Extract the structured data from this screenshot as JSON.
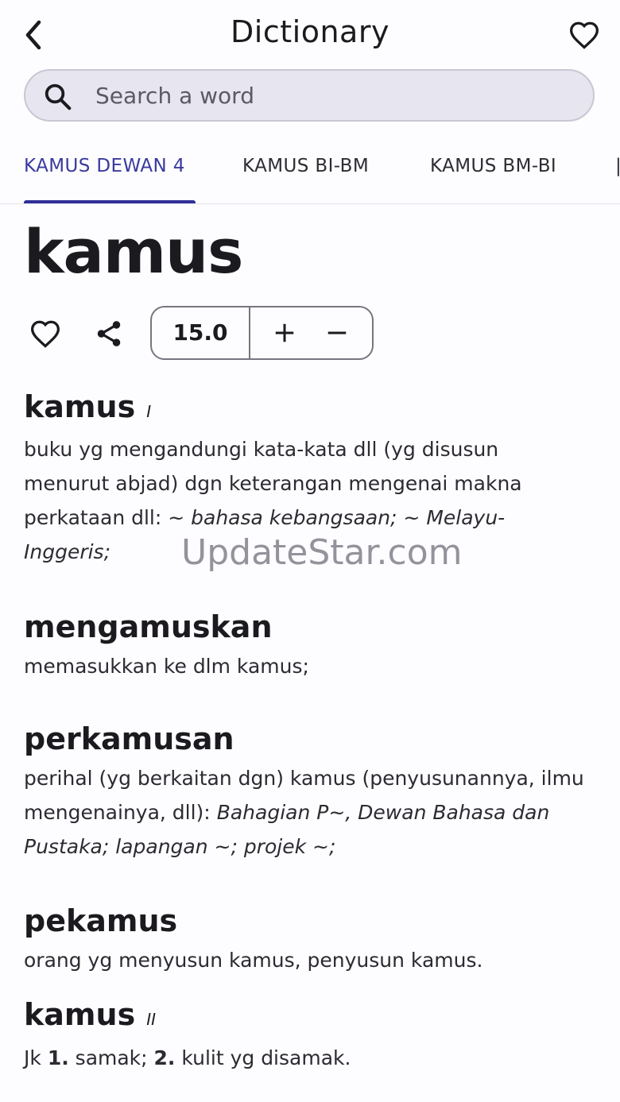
{
  "header": {
    "title": "Dictionary",
    "back_icon": "back-arrow-icon",
    "favorite_icon": "heart-outline-icon"
  },
  "search": {
    "placeholder": "Search a word",
    "value": ""
  },
  "tabs": [
    {
      "label": "KAMUS DEWAN 4",
      "active": true
    },
    {
      "label": "KAMUS BI-BM",
      "active": false
    },
    {
      "label": "KAMUS BM-BI",
      "active": false
    }
  ],
  "word": {
    "headword": "kamus",
    "font_size": "15.0",
    "favorite_icon": "heart-outline-icon",
    "share_icon": "share-icon",
    "increase_icon": "plus-icon",
    "decrease_icon": "minus-icon"
  },
  "entries": [
    {
      "word": "kamus",
      "number": "I",
      "definition": "buku yg mengandungi kata-kata dll (yg disusun menurut abjad) dgn keterangan mengenai makna perkataan dll: ",
      "examples": "~ bahasa kebangsaan; ~ Melayu-Inggeris;"
    },
    {
      "word": "mengamuskan",
      "definition": "memasukkan ke dlm kamus;"
    },
    {
      "word": "perkamusan",
      "definition": "perihal (yg berkaitan dgn) kamus (penyusunannya, ilmu mengenainya, dll): ",
      "examples": "Bahagian P~, Dewan Bahasa dan Pustaka; lapangan ~; projek ~;"
    },
    {
      "word": "pekamus",
      "definition": "orang yg menyusun kamus, penyusun kamus."
    },
    {
      "word": "kamus",
      "number": "II",
      "prefix": "Jk ",
      "sense1_num": "1.",
      "sense1": " samak; ",
      "sense2_num": "2.",
      "sense2": " kulit yg disamak."
    }
  ],
  "watermark": "UpdateStar.com",
  "colors": {
    "accent": "#2f2f97",
    "active_tab_text": "#3a3a9e",
    "background": "#fdfcff",
    "search_bg": "#e7e5ef"
  }
}
